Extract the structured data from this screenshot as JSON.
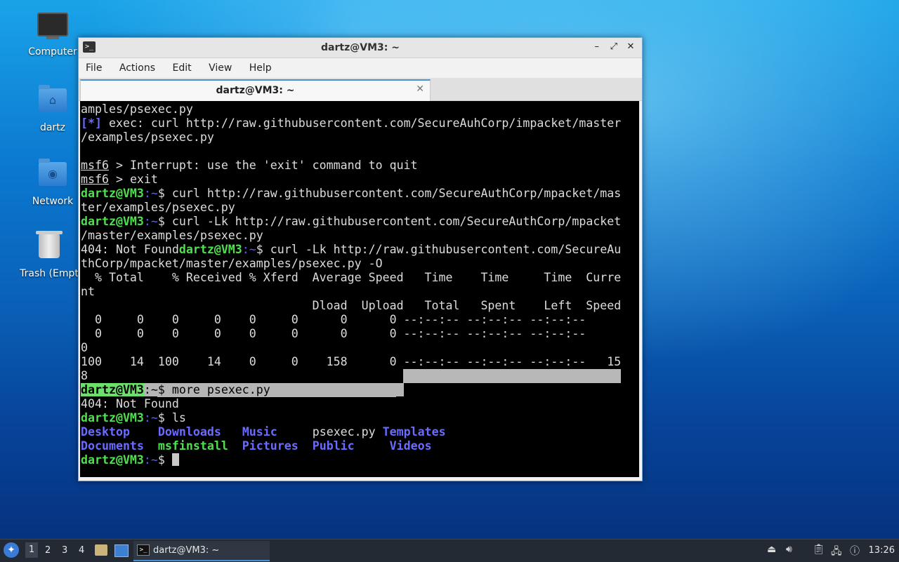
{
  "desktop": {
    "icons": [
      {
        "label": "Computer"
      },
      {
        "label": "dartz"
      },
      {
        "label": "Network"
      },
      {
        "label": "Trash (Empt"
      }
    ]
  },
  "window": {
    "title": "dartz@VM3: ~",
    "controls": {
      "minimize": "–",
      "maximize": "⤢",
      "close": "✕"
    },
    "menu": [
      "File",
      "Actions",
      "Edit",
      "View",
      "Help"
    ],
    "tab": {
      "label": "dartz@VM3: ~",
      "close": "✕"
    }
  },
  "terminal": {
    "prompt_user": "dartz@VM3",
    "prompt_path": ":~",
    "prompt_sign": "$",
    "lines": {
      "l1": "amples/psexec.py",
      "l2_tag": "[*]",
      "l2": " exec: curl http://raw.githubusercontent.com/SecureAuhCorp/impacket/master",
      "l3": "/examples/psexec.py",
      "msf": "msf6",
      "l5": " > Interrupt: use the 'exit' command to quit",
      "l6": " > exit",
      "c1": " curl http://raw.githubusercontent.com/SecureAuthCorp/mpacket/mas",
      "c1b": "ter/examples/psexec.py",
      "c2": " curl -Lk http://raw.githubusercontent.com/SecureAuthCorp/mpacket",
      "c2b": "/master/examples/psexec.py",
      "nf": "404: Not Found",
      "c3": " curl -Lk http://raw.githubusercontent.com/SecureAu",
      "c3b": "thCorp/mpacket/master/examples/psexec.py -O",
      "h1": "  % Total    % Received % Xferd  Average Speed   Time    Time     Time  Curre",
      "h1b": "nt",
      "h2": "                                 Dload  Upload   Total   Spent    Left  Speed",
      "r1": "  0     0    0     0    0     0      0      0 --:--:-- --:--:-- --:--:--",
      "r2": "  0     0    0     0    0     0      0      0 --:--:-- --:--:-- --:--:--",
      "r2b": "0",
      "r3": "100    14  100    14    0     0    158      0 --:--:-- --:--:-- --:--:--   15",
      "r3b": "8",
      "c4": " more psexec.py",
      "nf2": "404: Not Found",
      "c5": " ls",
      "ls_row1": [
        "Desktop",
        "Downloads",
        "Music",
        "psexec.py",
        "Templates"
      ],
      "ls_row2": [
        "Documents",
        "msfinstall",
        "Pictures",
        "Public",
        "Videos"
      ]
    }
  },
  "taskbar": {
    "start_icon": "start-menu-icon",
    "workspaces": [
      "1",
      "2",
      "3",
      "4"
    ],
    "task_label": "dartz@VM3: ~",
    "clock": "13:26"
  },
  "colors": {
    "prompt": "#4fe04f",
    "dir": "#6b6bff",
    "accent": "#4a90d9"
  }
}
